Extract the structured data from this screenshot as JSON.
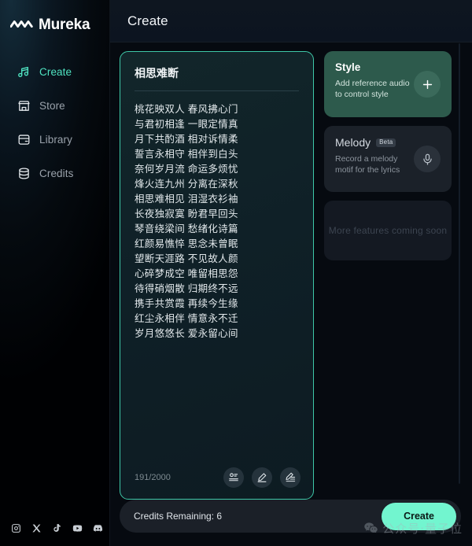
{
  "sidebar": {
    "logo_text": "Mureka",
    "logo_icon": "waveform-m-icon",
    "items": [
      {
        "label": "Create",
        "icon": "music-note-icon",
        "active": true
      },
      {
        "label": "Store",
        "icon": "storefront-icon",
        "active": false
      },
      {
        "label": "Library",
        "icon": "library-box-icon",
        "active": false
      },
      {
        "label": "Credits",
        "icon": "database-coins-icon",
        "active": false
      }
    ],
    "social": [
      {
        "name": "instagram-icon"
      },
      {
        "name": "x-twitter-icon"
      },
      {
        "name": "tiktok-icon"
      },
      {
        "name": "youtube-icon"
      },
      {
        "name": "discord-icon"
      }
    ]
  },
  "header": {
    "title": "Create"
  },
  "lyrics": {
    "title": "相思难断",
    "lines": [
      "桃花映双人 春风拂心门",
      "与君初相逢 一眼定情真",
      "月下共酌酒 相对诉情柔",
      "誓言永相守 相伴到白头",
      "奈何岁月流 命运多烦忧",
      "烽火连九州 分离在深秋",
      "相思难相见 泪湿衣衫袖",
      "长夜独寂寞 盼君早回头",
      "琴音绕梁间 愁绪化诗篇",
      "红颜易憔悴 思念未曾眠",
      "望断天涯路 不见故人颜",
      "心碎梦成空 唯留相思怨",
      "待得硝烟散 归期终不远",
      "携手共赏霞 再续今生缘",
      "红尘永相伴 情意永不迁",
      "岁月悠悠长 爱永留心间"
    ],
    "char_count": "191/2000",
    "footer_buttons": [
      {
        "name": "lyrics-assistant-icon"
      },
      {
        "name": "edit-pencil-icon"
      },
      {
        "name": "rewrite-pencil-icon"
      }
    ]
  },
  "right_panel": {
    "style_card": {
      "title": "Style",
      "subtitle": "Add reference audio\nto control style",
      "action_icon": "plus-icon",
      "bg_color": "#2d5a4c"
    },
    "melody_card": {
      "title": "Melody",
      "badge": "Beta",
      "subtitle": "Record a melody\nmotif for the lyrics",
      "action_icon": "microphone-icon",
      "bg_color": "#1b2129"
    },
    "coming_soon": {
      "text": "More features coming soon"
    }
  },
  "bottom": {
    "credits_text": "Credits Remaining: 6",
    "create_label": "Create",
    "create_color": "#72f5cf"
  },
  "watermark": {
    "text": "公众号·量子位",
    "icon": "wechat-icon"
  },
  "theme": {
    "accent": "#4fe3c1",
    "panel_border": "#3ec8a8",
    "sidebar_bg": "#0a1620",
    "app_bg": "#05070a"
  }
}
